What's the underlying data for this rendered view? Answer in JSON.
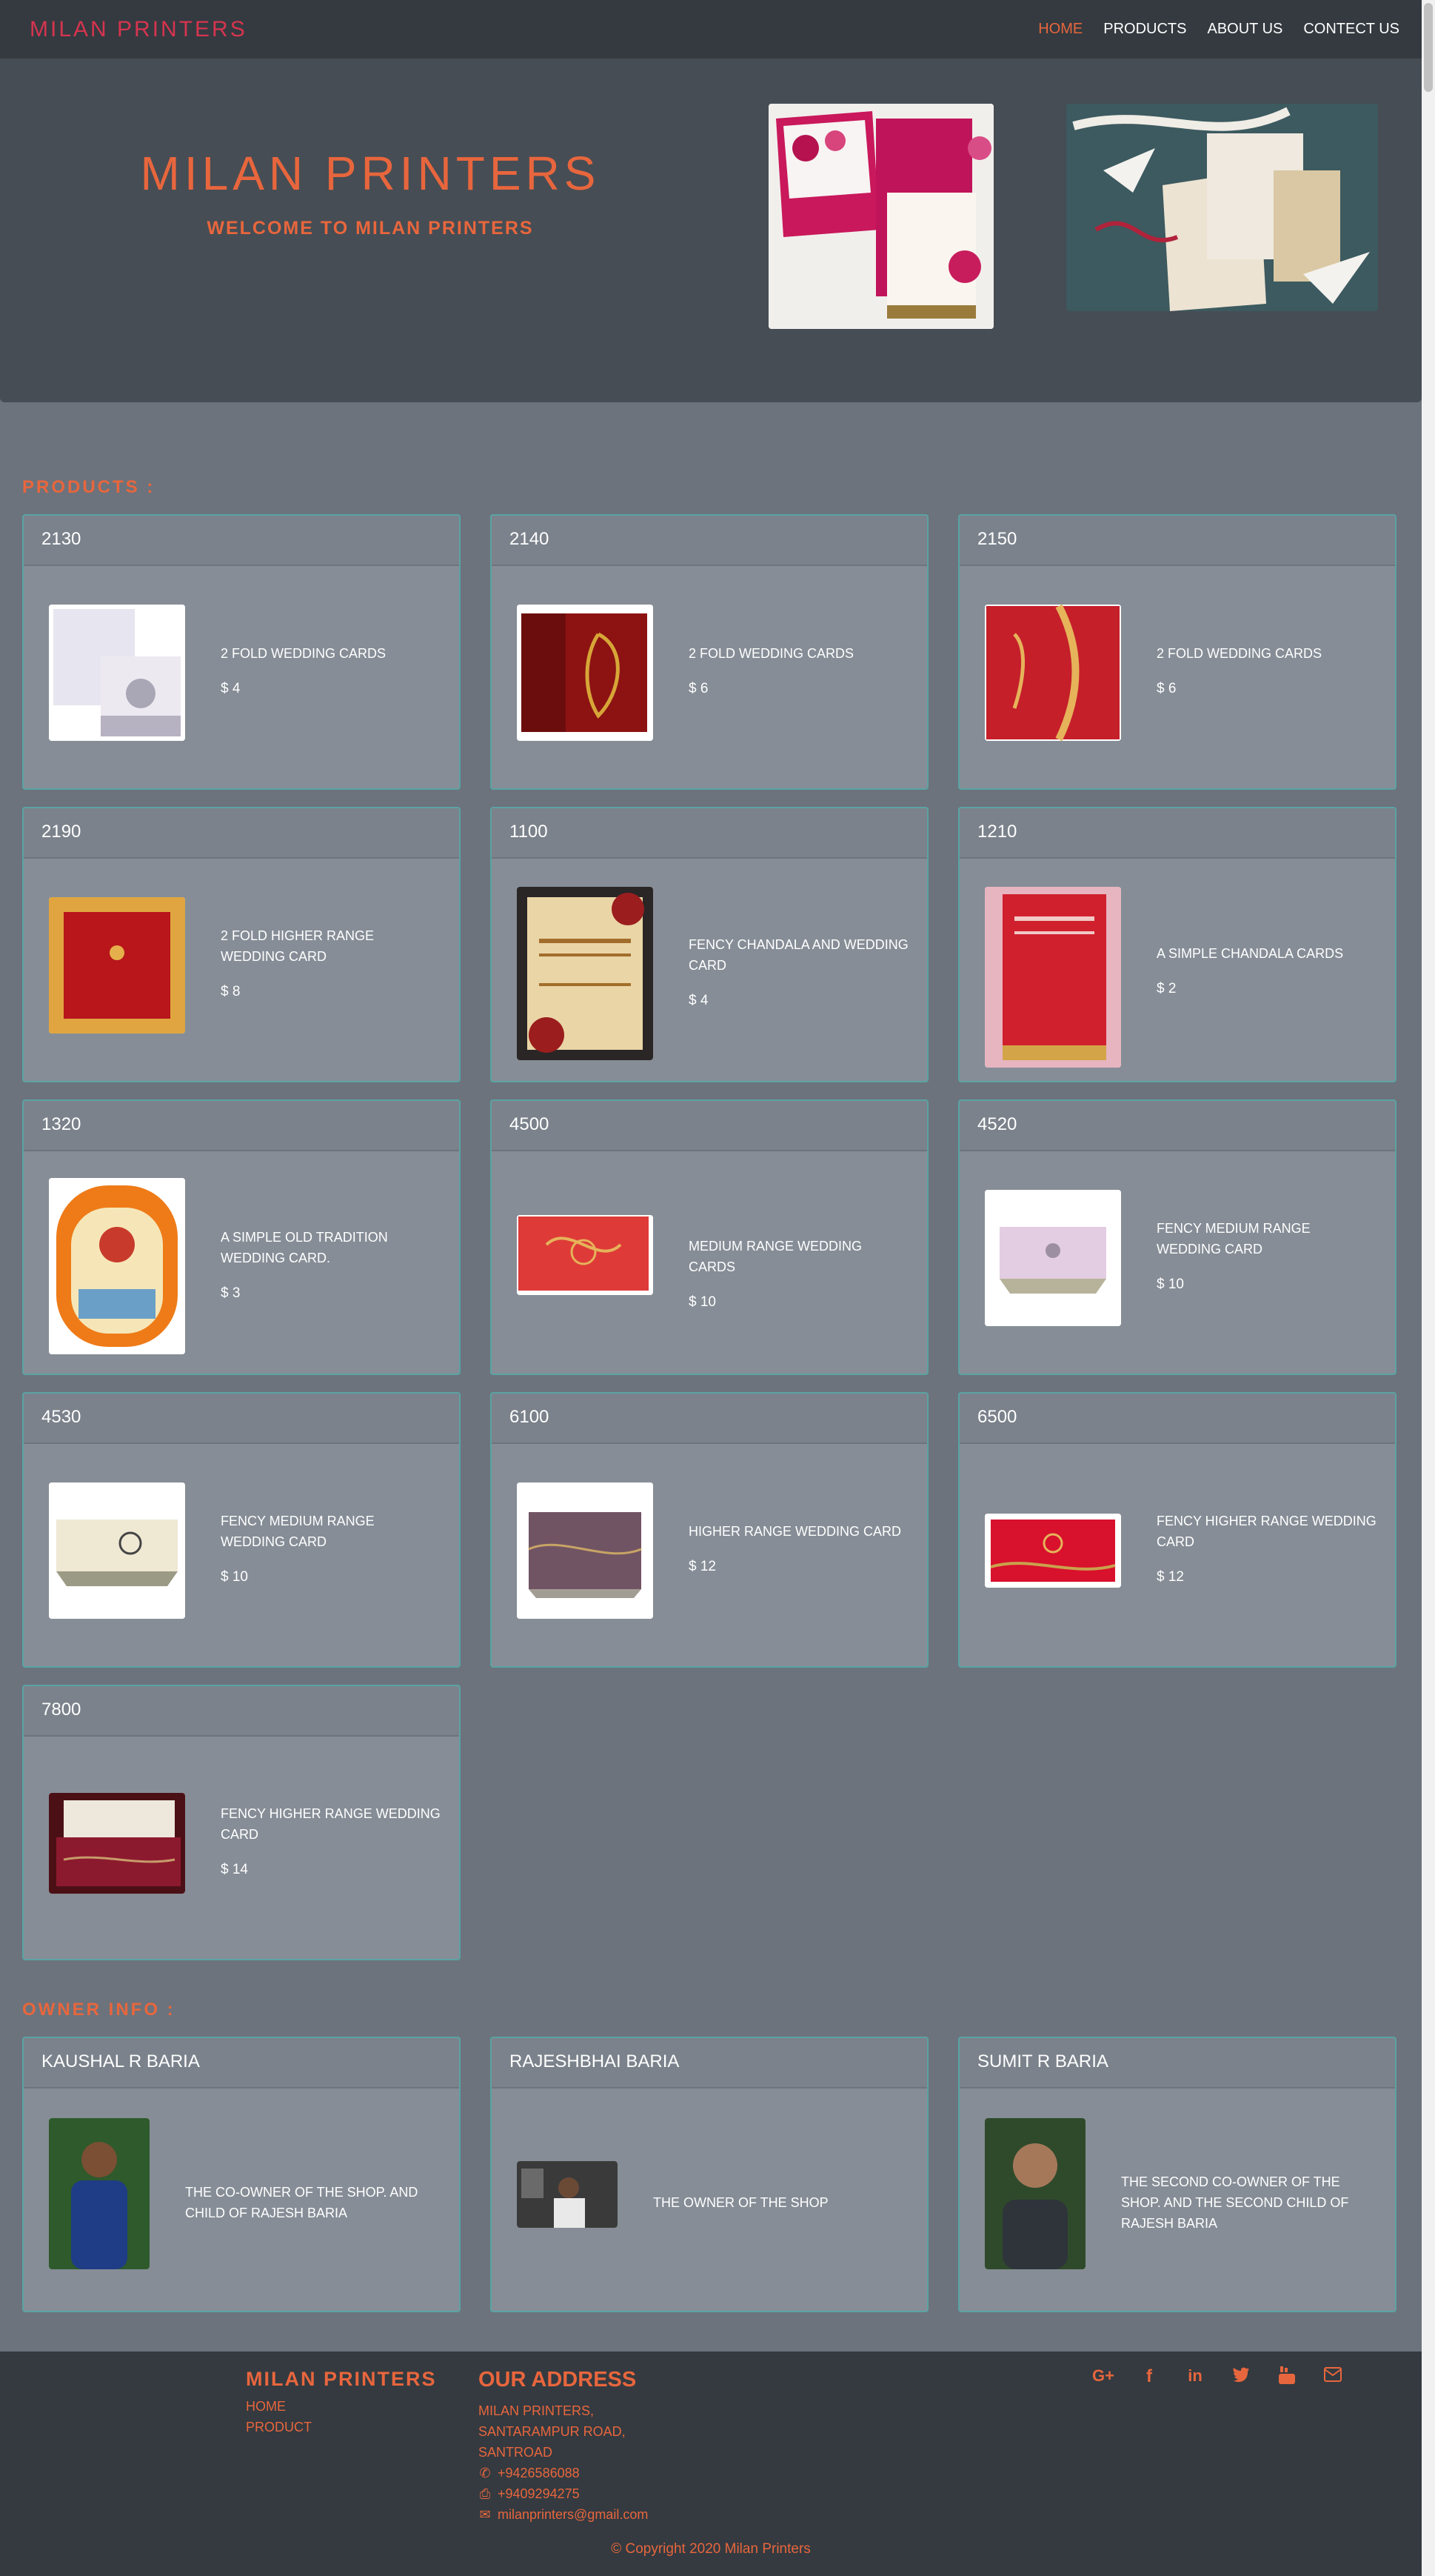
{
  "nav": {
    "brand": "MILAN PRINTERS",
    "links": [
      "HOME",
      "PRODUCTS",
      "ABOUT US",
      "CONTECT US"
    ]
  },
  "hero": {
    "title": "MILAN PRINTERS",
    "subtitle": "WELCOME TO MILAN PRINTERS"
  },
  "products_title": "PRODUCTS :",
  "products": [
    {
      "code": "2130",
      "name": "2 FOLD WEDDING CARDS",
      "price": "$ 4"
    },
    {
      "code": "2140",
      "name": "2 FOLD WEDDING CARDS",
      "price": "$ 6"
    },
    {
      "code": "2150",
      "name": "2 FOLD WEDDING CARDS",
      "price": "$ 6"
    },
    {
      "code": "2190",
      "name": "2 FOLD HIGHER RANGE WEDDING CARD",
      "price": "$ 8"
    },
    {
      "code": "1100",
      "name": "FENCY CHANDALA AND WEDDING CARD",
      "price": "$ 4"
    },
    {
      "code": "1210",
      "name": "A SIMPLE CHANDALA CARDS",
      "price": "$ 2"
    },
    {
      "code": "1320",
      "name": "A SIMPLE OLD TRADITION WEDDING CARD.",
      "price": "$ 3"
    },
    {
      "code": "4500",
      "name": "MEDIUM RANGE WEDDING CARDS",
      "price": "$ 10"
    },
    {
      "code": "4520",
      "name": "FENCY MEDIUM RANGE WEDDING CARD",
      "price": "$ 10"
    },
    {
      "code": "4530",
      "name": "FENCY MEDIUM RANGE WEDDING CARD",
      "price": "$ 10"
    },
    {
      "code": "6100",
      "name": "HIGHER RANGE WEDDING CARD",
      "price": "$ 12"
    },
    {
      "code": "6500",
      "name": "FENCY HIGHER RANGE WEDDING CARD",
      "price": "$ 12"
    },
    {
      "code": "7800",
      "name": "FENCY HIGHER RANGE WEDDING CARD",
      "price": "$ 14"
    }
  ],
  "owner_title": "OWNER INFO :",
  "owners": [
    {
      "name": "KAUSHAL R BARIA",
      "desc": "THE CO-OWNER OF THE SHOP. AND CHILD OF RAJESH BARIA"
    },
    {
      "name": "RAJESHBHAI BARIA",
      "desc": "THE OWNER OF THE SHOP"
    },
    {
      "name": "SUMIT R BARIA",
      "desc": "THE SECOND CO-OWNER OF THE SHOP. AND THE SECOND CHILD OF RAJESH BARIA"
    }
  ],
  "footer": {
    "brand": "MILAN PRINTERS",
    "links": [
      "HOME",
      "PRODUCT"
    ],
    "address_title": "OUR ADDRESS",
    "address": [
      "MILAN PRINTERS,",
      "SANTARAMPUR ROAD,",
      "SANTROAD"
    ],
    "phone": "+9426586088",
    "fax": "+9409294275",
    "email": "milanprinters@gmail.com",
    "copyright": "© Copyright 2020 Milan Printers"
  },
  "social_icons": [
    "google-plus-icon",
    "facebook-icon",
    "linkedin-icon",
    "twitter-icon",
    "youtube-icon",
    "envelope-icon"
  ],
  "colors": {
    "accent": "#e8663d",
    "brand_red": "#d6344f",
    "nav_bg": "#343a40",
    "card_border": "#5aa3a3"
  }
}
